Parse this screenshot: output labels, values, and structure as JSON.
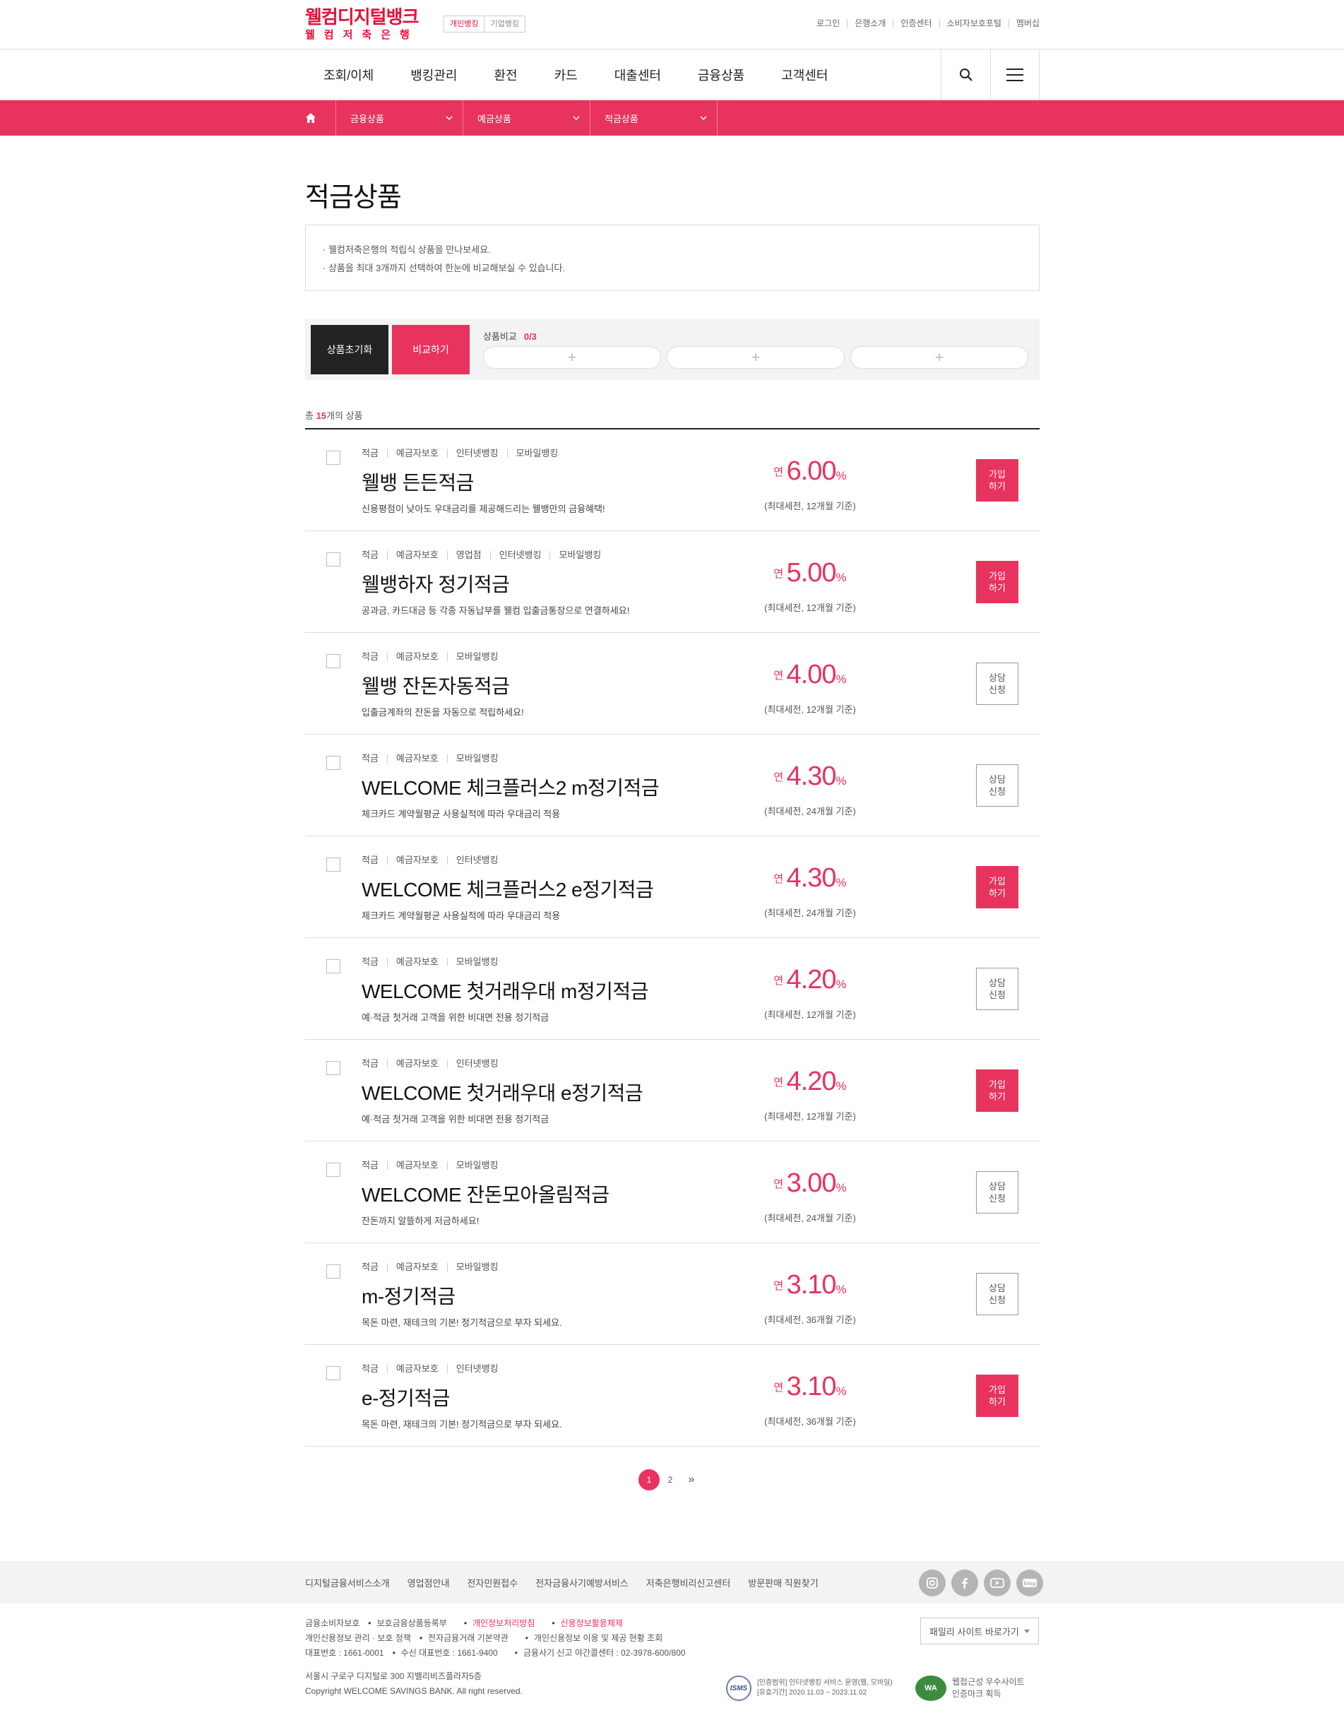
{
  "header": {
    "logo_line1": "웰컴디지털뱅크",
    "logo_line2": "웰컴저축은행",
    "bank_tabs": [
      "개인뱅킹",
      "기업뱅킹"
    ],
    "util_links": [
      "로그인",
      "은행소개",
      "인증센터",
      "소비자보호포털",
      "멤버십"
    ]
  },
  "gnb": {
    "menu": [
      "조회/이체",
      "뱅킹관리",
      "환전",
      "카드",
      "대출센터",
      "금융상품",
      "고객센터"
    ],
    "search_icon": "search-icon",
    "menu_icon": "hamburger-icon"
  },
  "breadcrumb": {
    "items": [
      "금융상품",
      "예금상품",
      "적금상품"
    ]
  },
  "page": {
    "title": "적금상품",
    "intro": [
      "웰컴저축은행의 적립식 상품을 만나보세요.",
      "상품을 최대 3개까지 선택하여 한눈에 비교해보실 수 있습니다."
    ]
  },
  "compare": {
    "reset_label": "상품초기화",
    "compare_label": "비교하기",
    "title": "상품비교",
    "count": "0/3",
    "slot_symbol": "+"
  },
  "list": {
    "count_prefix": "총 ",
    "count": "15",
    "count_suffix": "개의 상품",
    "rate_prefix": "연",
    "rate_suffix": "%",
    "products": [
      {
        "tags": [
          "적금",
          "예금자보호",
          "인터넷뱅킹",
          "모바일뱅킹"
        ],
        "name": "웰뱅 든든적금",
        "desc": "신용평점이 낮아도 우대금리를 제공해드리는 웰뱅만의 금융혜택!",
        "rate": "6.00",
        "cond": "(최대세전, 12개월 기준)",
        "action": "가입\n하기",
        "action_type": "join"
      },
      {
        "tags": [
          "적금",
          "예금자보호",
          "영업점",
          "인터넷뱅킹",
          "모바일뱅킹"
        ],
        "name": "웰뱅하자 정기적금",
        "desc": "공과금, 카드대금 등 각종 자동납부를 웰컴 입출금통장으로 연결하세요!",
        "rate": "5.00",
        "cond": "(최대세전, 12개월 기준)",
        "action": "가입\n하기",
        "action_type": "join"
      },
      {
        "tags": [
          "적금",
          "예금자보호",
          "모바일뱅킹"
        ],
        "name": "웰뱅 잔돈자동적금",
        "desc": "입출금계좌의 잔돈을 자동으로 적립하세요!",
        "rate": "4.00",
        "cond": "(최대세전, 12개월 기준)",
        "action": "상담\n신청",
        "action_type": "consult"
      },
      {
        "tags": [
          "적금",
          "예금자보호",
          "모바일뱅킹"
        ],
        "name": "WELCOME 체크플러스2 m정기적금",
        "desc": "체크카드 계약월평균 사용실적에 따라 우대금리 적용",
        "rate": "4.30",
        "cond": "(최대세전, 24개월 기준)",
        "action": "상담\n신청",
        "action_type": "consult"
      },
      {
        "tags": [
          "적금",
          "예금자보호",
          "인터넷뱅킹"
        ],
        "name": "WELCOME 체크플러스2 e정기적금",
        "desc": "체크카드 계약월평균 사용실적에 따라 우대금리 적용",
        "rate": "4.30",
        "cond": "(최대세전, 24개월 기준)",
        "action": "가입\n하기",
        "action_type": "join"
      },
      {
        "tags": [
          "적금",
          "예금자보호",
          "모바일뱅킹"
        ],
        "name": "WELCOME 첫거래우대 m정기적금",
        "desc": "예·적금 첫거래 고객을 위한 비대면 전용 정기적금",
        "rate": "4.20",
        "cond": "(최대세전, 12개월 기준)",
        "action": "상담\n신청",
        "action_type": "consult"
      },
      {
        "tags": [
          "적금",
          "예금자보호",
          "인터넷뱅킹"
        ],
        "name": "WELCOME 첫거래우대 e정기적금",
        "desc": "예·적금 첫거래 고객을 위한 비대면 전용 정기적금",
        "rate": "4.20",
        "cond": "(최대세전, 12개월 기준)",
        "action": "가입\n하기",
        "action_type": "join"
      },
      {
        "tags": [
          "적금",
          "예금자보호",
          "모바일뱅킹"
        ],
        "name": "WELCOME 잔돈모아올림적금",
        "desc": "잔돈까지 알뜰하게 저금하세요!",
        "rate": "3.00",
        "cond": "(최대세전, 24개월 기준)",
        "action": "상담\n신청",
        "action_type": "consult"
      },
      {
        "tags": [
          "적금",
          "예금자보호",
          "모바일뱅킹"
        ],
        "name": "m-정기적금",
        "desc": "목돈 마련, 재테크의 기본! 정기적금으로 부자 되세요.",
        "rate": "3.10",
        "cond": "(최대세전, 36개월 기준)",
        "action": "상담\n신청",
        "action_type": "consult"
      },
      {
        "tags": [
          "적금",
          "예금자보호",
          "인터넷뱅킹"
        ],
        "name": "e-정기적금",
        "desc": "목돈 마련, 재테크의 기본! 정기적금으로 부자 되세요.",
        "rate": "3.10",
        "cond": "(최대세전, 36개월 기준)",
        "action": "가입\n하기",
        "action_type": "join"
      }
    ]
  },
  "pagination": {
    "pages": [
      "1",
      "2"
    ],
    "current": "1",
    "next_symbol": "»"
  },
  "footer": {
    "nav_links": [
      "디지털금융서비스소개",
      "영업점안내",
      "전자민원접수",
      "전자금융사기예방서비스",
      "저축은행비리신고센터",
      "방문판매 직원찾기"
    ],
    "sns_icons": [
      "instagram-icon",
      "facebook-icon",
      "youtube-icon",
      "blog-icon"
    ],
    "policy_line1": [
      "금융소비자보호",
      "보호금융상품등록부",
      "개인정보처리방침",
      "신용정보활용체제"
    ],
    "policy_line2": [
      "개인신용정보 관리 · 보호 정책",
      "전자금융거래 기본약관",
      "개인신용정보 이용 및 제공 현황 조회"
    ],
    "phone_line": [
      "대표번호 : 1661-0001",
      "수신 대표번호 : 1661-9400",
      "금융사기 신고 야간콜센터 : 02-3978-600/800"
    ],
    "address": "서울시 구로구 디지털로 300 지밸리비즈플라자5층",
    "copyright": "Copyright WELCOME SAVINGS BANK. All right reserved.",
    "family_site": "패밀리 사이트 바로가기",
    "cert1_logo": "ISMS",
    "cert1_text": [
      "[인증범위] 인터넷뱅킹 서비스 운영(웹, 모바일)",
      "[유효기간] 2020.11.03 ~ 2023.11.02"
    ],
    "cert2_logo": "WA",
    "cert2_text": [
      "웹접근성 우수사이트",
      "인증마크 획득"
    ]
  }
}
